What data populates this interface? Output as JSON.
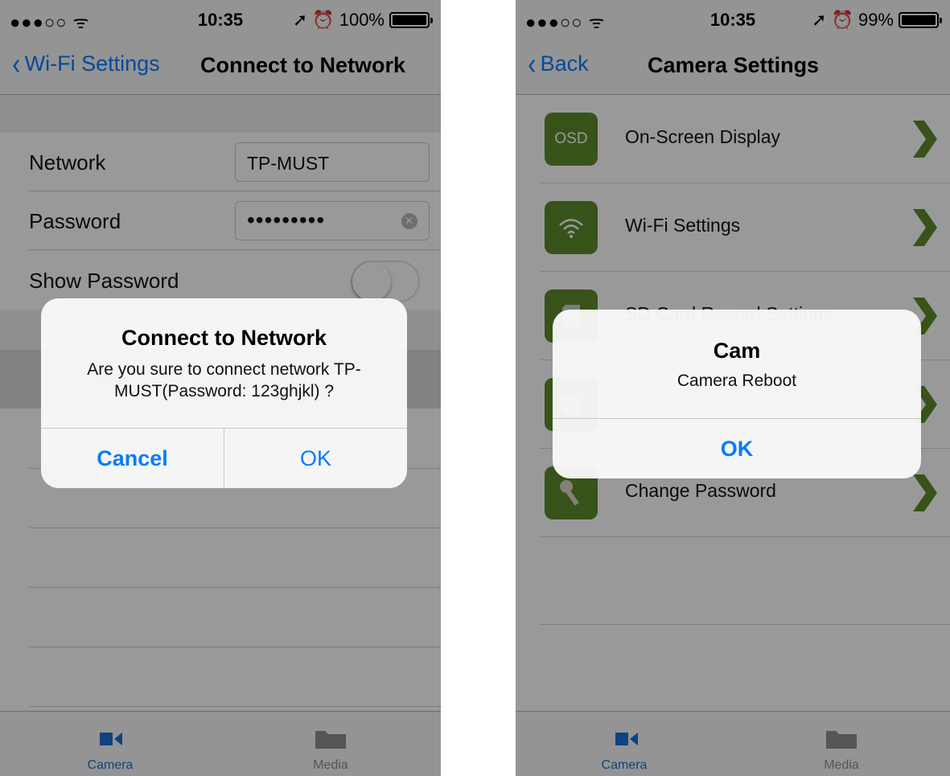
{
  "left": {
    "status": {
      "signal": "●●●○○ ᯤ",
      "time": "10:35",
      "battery": "100%",
      "battery_level": 1.0
    },
    "nav": {
      "back_label": "Wi-Fi Settings",
      "title": "Connect to Network"
    },
    "form": {
      "network_label": "Network",
      "network_value": "TP-MUST",
      "password_label": "Password",
      "password_value": "•••••••••",
      "show_password_label": "Show Password",
      "show_password_on": false
    },
    "alert": {
      "title": "Connect to Network",
      "message": "Are you sure to connect network TP-MUST(Password: 123ghjkl) ?",
      "cancel": "Cancel",
      "ok": "OK"
    },
    "tabs": [
      {
        "label": "Camera",
        "icon": "video-camera-icon",
        "active": true
      },
      {
        "label": "Media",
        "icon": "folder-icon",
        "active": false
      }
    ]
  },
  "right": {
    "status": {
      "signal": "●●●○○ ᯤ",
      "time": "10:35",
      "battery": "99%",
      "battery_level": 0.99
    },
    "nav": {
      "back_label": "Back",
      "title": "Camera Settings"
    },
    "items": [
      {
        "label": "On-Screen Display",
        "icon": "osd-icon",
        "icon_text": "OSD"
      },
      {
        "label": "Wi-Fi Settings",
        "icon": "wifi-icon"
      },
      {
        "label": "SD Card Record Settings",
        "icon": "sd-card-icon"
      },
      {
        "label": "",
        "icon": "camera-lens-icon"
      },
      {
        "label": "Change Password",
        "icon": "key-icon"
      }
    ],
    "alert": {
      "title": "Cam",
      "message": "Camera Reboot",
      "ok": "OK"
    },
    "tabs": [
      {
        "label": "Camera",
        "icon": "video-camera-icon",
        "active": true
      },
      {
        "label": "Media",
        "icon": "folder-icon",
        "active": false
      }
    ]
  },
  "colors": {
    "ios_blue": "#0a7aff",
    "brand_green": "#5e8a2a",
    "tab_active": "#1a6fd8"
  }
}
